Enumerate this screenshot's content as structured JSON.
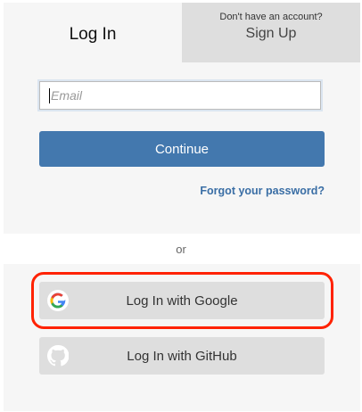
{
  "tabs": {
    "login": "Log In",
    "signup_prompt": "Don't have an account?",
    "signup": "Sign Up"
  },
  "form": {
    "email_placeholder": "Email",
    "email_value": "",
    "continue": "Continue",
    "forgot": "Forgot your password?"
  },
  "divider": "or",
  "social": {
    "google": "Log In with Google",
    "github": "Log In with GitHub"
  },
  "colors": {
    "primary": "#4378ae",
    "highlight": "#ff2200"
  }
}
